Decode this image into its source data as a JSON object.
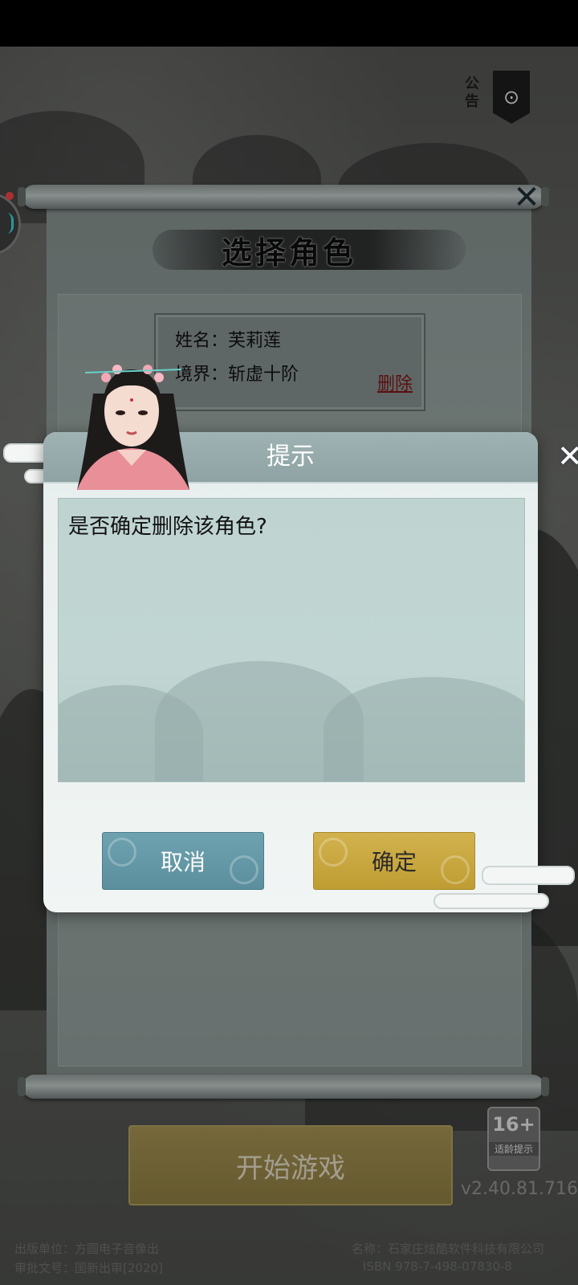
{
  "scroll": {
    "title": "选择角色"
  },
  "notice": {
    "label": "公告"
  },
  "character": {
    "name_line": "姓名：芙莉莲",
    "realm_line": "境界：斩虚十阶",
    "delete_label": "删除"
  },
  "dialog": {
    "title": "提示",
    "message": "是否确定删除该角色?",
    "cancel_label": "取消",
    "confirm_label": "确定"
  },
  "start": {
    "label": "开始游戏"
  },
  "age_rating": {
    "number": "16+",
    "label": "适龄提示"
  },
  "version": "v2.40.81.716",
  "footer": {
    "line1_left": "出版单位：方圆电子音像出",
    "line1_right": "名称：石家庄炫酷软件科技有限公司",
    "line2_left": "审批文号：国新出审[2020]",
    "line2_right": "ISBN 978-7-498-07830-8"
  },
  "colors": {
    "cancel_button": "#5b8f9e",
    "confirm_button": "#bf9d33",
    "dialog_header": "#8fa3a4"
  }
}
